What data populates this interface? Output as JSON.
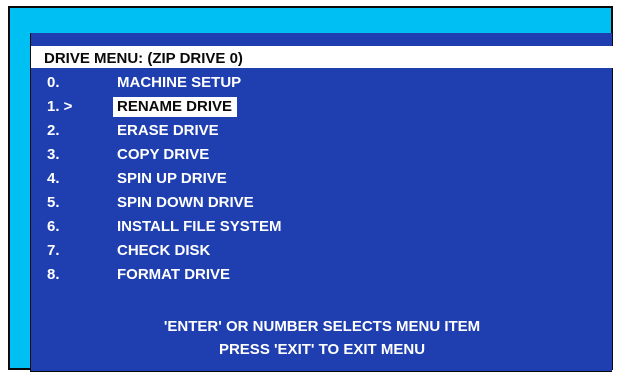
{
  "menu": {
    "title": "DRIVE MENU: (ZIP DRIVE 0)",
    "items": [
      {
        "number": "0.",
        "label": "MACHINE SETUP"
      },
      {
        "number": "1. >",
        "label": "RENAME DRIVE"
      },
      {
        "number": "2.",
        "label": "ERASE DRIVE"
      },
      {
        "number": "3.",
        "label": "COPY DRIVE"
      },
      {
        "number": "4.",
        "label": "SPIN UP DRIVE"
      },
      {
        "number": "5.",
        "label": "SPIN DOWN DRIVE"
      },
      {
        "number": "6.",
        "label": "INSTALL FILE SYSTEM"
      },
      {
        "number": "7.",
        "label": "CHECK DISK"
      },
      {
        "number": "8.",
        "label": "FORMAT DRIVE"
      }
    ],
    "selected_index": 1
  },
  "footer": {
    "line1": "'ENTER' OR NUMBER SELECTS MENU ITEM",
    "line2": "PRESS 'EXIT' TO EXIT MENU"
  },
  "colors": {
    "frame": "#00bff3",
    "screen": "#1f3fb0",
    "highlight": "#ffffff",
    "text": "#ffffff"
  }
}
